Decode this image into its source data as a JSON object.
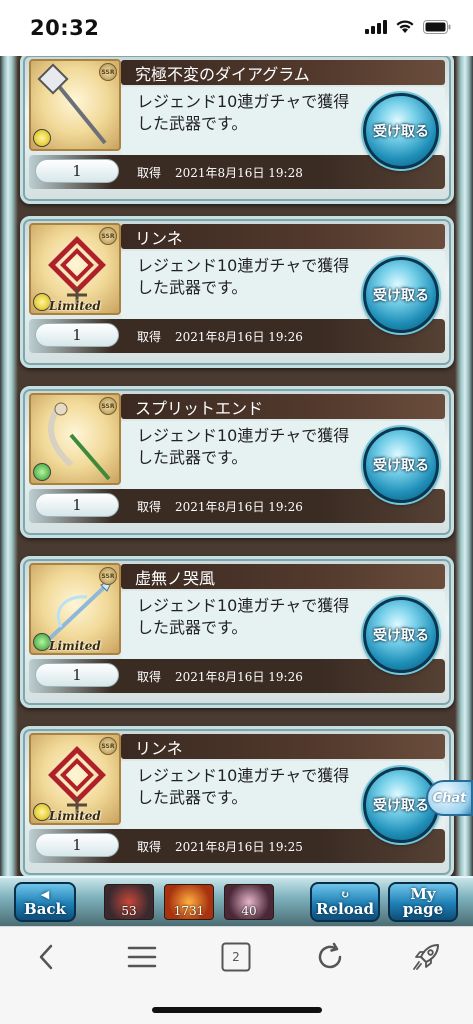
{
  "status_bar": {
    "time": "20:32",
    "icons": [
      "cellular-signal-icon",
      "wifi-icon",
      "battery-icon"
    ]
  },
  "items": [
    {
      "title": "究極不変のダイアグラム",
      "description": "レジェンド10連ガチャで獲得した武器です。",
      "quantity": "1",
      "obtained_label": "取得",
      "obtained_date": "2021年8月16日 19:28",
      "button": "受け取る",
      "rarity": "SSR",
      "element": "light",
      "limited": false,
      "icon": "staff-weapon-icon"
    },
    {
      "title": "リンネ",
      "description": "レジェンド10連ガチャで獲得した武器です。",
      "quantity": "1",
      "obtained_label": "取得",
      "obtained_date": "2021年8月16日 19:26",
      "button": "受け取る",
      "rarity": "SSR",
      "element": "light",
      "limited": true,
      "limited_text": "Limited",
      "icon": "knot-weapon-icon"
    },
    {
      "title": "スプリットエンド",
      "description": "レジェンド10連ガチャで獲得した武器です。",
      "quantity": "1",
      "obtained_label": "取得",
      "obtained_date": "2021年8月16日 19:26",
      "button": "受け取る",
      "rarity": "SSR",
      "element": "wind",
      "limited": false,
      "icon": "harp-weapon-icon"
    },
    {
      "title": "虚無ノ哭風",
      "description": "レジェンド10連ガチャで獲得した武器です。",
      "quantity": "1",
      "obtained_label": "取得",
      "obtained_date": "2021年8月16日 19:26",
      "button": "受け取る",
      "rarity": "SSR",
      "element": "wind",
      "limited": true,
      "limited_text": "Limited",
      "icon": "spear-weapon-icon"
    },
    {
      "title": "リンネ",
      "description": "レジェンド10連ガチャで獲得した武器です。",
      "quantity": "1",
      "obtained_label": "取得",
      "obtained_date": "2021年8月16日 19:25",
      "button": "受け取る",
      "rarity": "SSR",
      "element": "light",
      "limited": true,
      "limited_text": "Limited",
      "icon": "knot-weapon-icon"
    }
  ],
  "chat_label": "Chat",
  "game_nav": {
    "back_label": "Back",
    "orbs": [
      {
        "value": "53",
        "color": "#3a2a30"
      },
      {
        "value": "1731",
        "color": "#a83210"
      },
      {
        "value": "40",
        "color": "#4a2838"
      }
    ],
    "reload_label": "Reload",
    "mypage_label_top": "My",
    "mypage_label_bottom": "page"
  },
  "browser": {
    "tab_count": "2",
    "buttons": [
      "back-chevron-icon",
      "bookmarks-icon",
      "tabs-icon",
      "reload-icon",
      "rocket-icon"
    ]
  }
}
